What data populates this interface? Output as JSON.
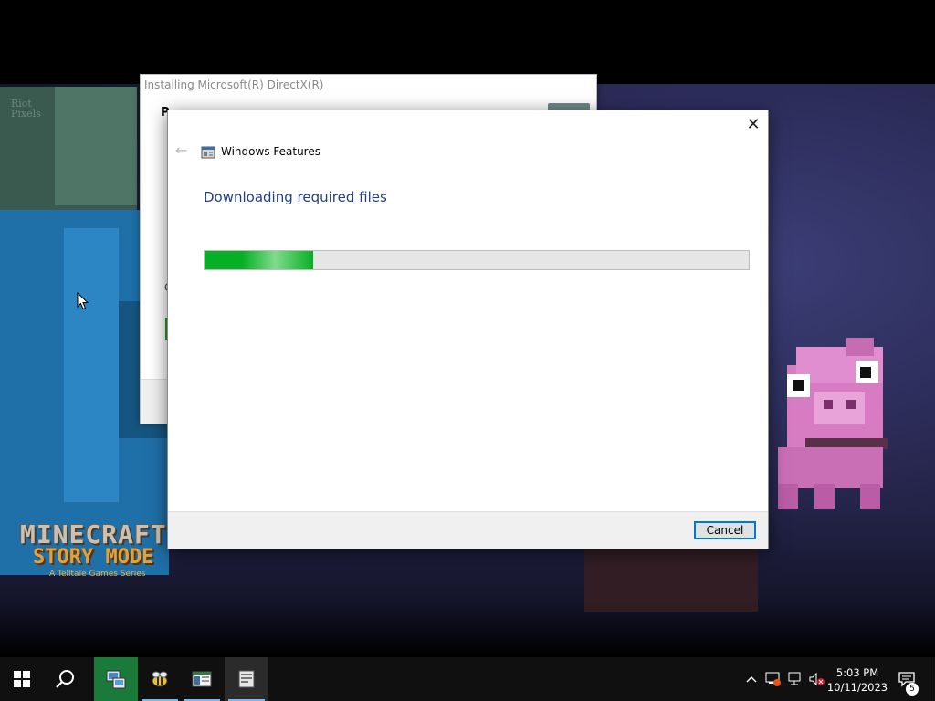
{
  "wallpaper": {
    "watermark": "Riot\nPixels",
    "logo_line1": "MINECRAFT",
    "logo_line2": "STORY MODE",
    "logo_line3": "A Telltale Games Series"
  },
  "background_window": {
    "title": "Installing Microsoft(R) DirectX(R)",
    "fragment_p": "P",
    "fragment_c": "C"
  },
  "dialog": {
    "title": "Windows Features",
    "heading": "Downloading required files",
    "progress_fraction": 0.2,
    "cancel_label": "Cancel",
    "close_glyph": "✕",
    "back_glyph": "←"
  },
  "taskbar": {
    "clock_time": "5:03 PM",
    "clock_date": "10/11/2023",
    "notification_count": "5",
    "accent": "#0078d7"
  },
  "icons": {
    "start": "windows-logo-icon",
    "search": "search-icon",
    "tray_chevron": "chevron-up-icon",
    "notification": "action-center-icon"
  }
}
